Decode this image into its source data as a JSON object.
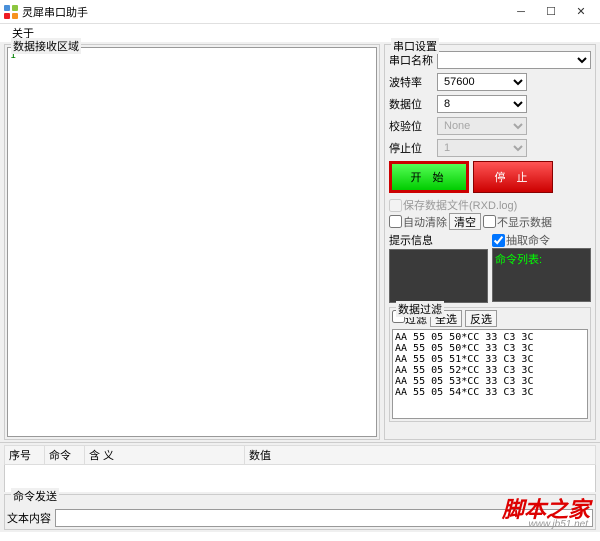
{
  "window": {
    "title": "灵犀串口助手"
  },
  "menu": {
    "about": "关于"
  },
  "recv": {
    "label": "数据接收区域",
    "content": "1"
  },
  "settings": {
    "label": "串口设置",
    "port": {
      "label": "串口名称",
      "value": ""
    },
    "baud": {
      "label": "波特率",
      "value": "57600"
    },
    "databits": {
      "label": "数据位",
      "value": "8"
    },
    "parity": {
      "label": "校验位",
      "value": "None"
    },
    "stopbits": {
      "label": "停止位",
      "value": "1"
    },
    "start": "开  始",
    "stop": "停  止",
    "save_log": "保存数据文件(RXD.log)",
    "auto_clear": "自动清除",
    "clear_btn": "清空",
    "no_display": "不显示数据",
    "hint_label": "提示信息",
    "extract": "抽取命令",
    "cmd_list_label": "命令列表:"
  },
  "filter": {
    "label": "数据过滤",
    "chk": "过滤",
    "select_all": "全选",
    "invert": "反选",
    "lines": "AA 55 05 50*CC 33 C3 3C\nAA 55 05 50*CC 33 C3 3C\nAA 55 05 51*CC 33 C3 3C\nAA 55 05 52*CC 33 C3 3C\nAA 55 05 53*CC 33 C3 3C\nAA 55 05 54*CC 33 C3 3C"
  },
  "table": {
    "seq": "序号",
    "cmd": "命令",
    "meaning": "含  义",
    "value": "数值"
  },
  "send": {
    "label": "命令发送",
    "text_label": "文本内容"
  },
  "watermark": {
    "text": "脚本之家",
    "url": "www.jb51.net"
  }
}
